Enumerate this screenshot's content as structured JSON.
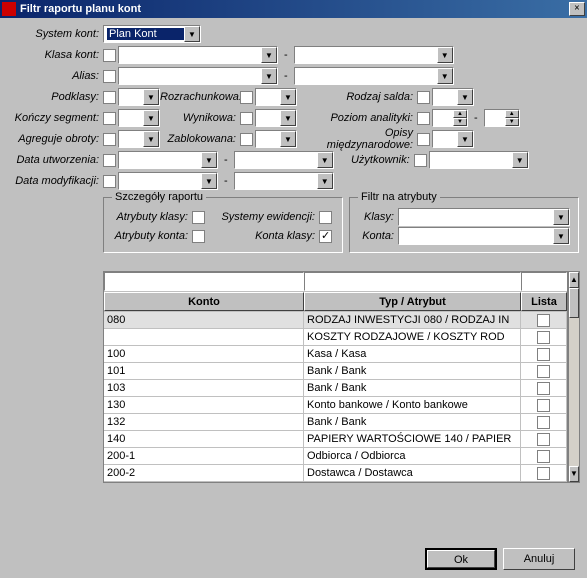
{
  "window": {
    "title": "Filtr raportu planu kont",
    "close": "×"
  },
  "labels": {
    "system_kont": "System kont:",
    "klasa_kont": "Klasa kont:",
    "alias": "Alias:",
    "podklasy": "Podklasy:",
    "konczy_segment": "Kończy segment:",
    "agreguje_obroty": "Agreguje obroty:",
    "data_utworzenia": "Data utworzenia:",
    "data_modyfikacji": "Data modyfikacji:",
    "rozrachunkowa": "Rozrachunkowa:",
    "wynikowa": "Wynikowa:",
    "zablokowana": "Zablokowana:",
    "rodzaj_salda": "Rodzaj salda:",
    "poziom_analityki": "Poziom analityki:",
    "opisy_miedzynarodowe": "Opisy międzynarodowe:",
    "uzytkownik": "Użytkownik:"
  },
  "system_kont_value": "Plan Kont",
  "szczegoly": {
    "title": "Szczegóły raportu",
    "atrybuty_klasy": "Atrybuty klasy:",
    "atrybuty_konta": "Atrybuty konta:",
    "systemy_ewidencji": "Systemy ewidencji:",
    "konta_klasy": "Konta klasy:",
    "konta_klasy_checked": true
  },
  "filtr_atrybuty": {
    "title": "Filtr na atrybuty",
    "klasy": "Klasy:",
    "konta": "Konta:"
  },
  "grid": {
    "headers": {
      "konto": "Konto",
      "typ": "Typ / Atrybut",
      "lista": "Lista"
    },
    "rows": [
      {
        "konto": "080",
        "typ": "RODZAJ INWESTYCJI 080 / RODZAJ IN"
      },
      {
        "konto": "",
        "typ": "KOSZTY RODZAJOWE / KOSZTY ROD"
      },
      {
        "konto": "100",
        "typ": "Kasa / Kasa"
      },
      {
        "konto": "101",
        "typ": "Bank / Bank"
      },
      {
        "konto": "103",
        "typ": "Bank / Bank"
      },
      {
        "konto": "130",
        "typ": "Konto bankowe / Konto bankowe"
      },
      {
        "konto": "132",
        "typ": "Bank / Bank"
      },
      {
        "konto": "140",
        "typ": "PAPIERY WARTOŚCIOWE 140 / PAPIER"
      },
      {
        "konto": "200-1",
        "typ": "Odbiorca / Odbiorca"
      },
      {
        "konto": "200-2",
        "typ": "Dostawca / Dostawca"
      }
    ]
  },
  "buttons": {
    "ok": "Ok",
    "cancel": "Anuluj"
  }
}
